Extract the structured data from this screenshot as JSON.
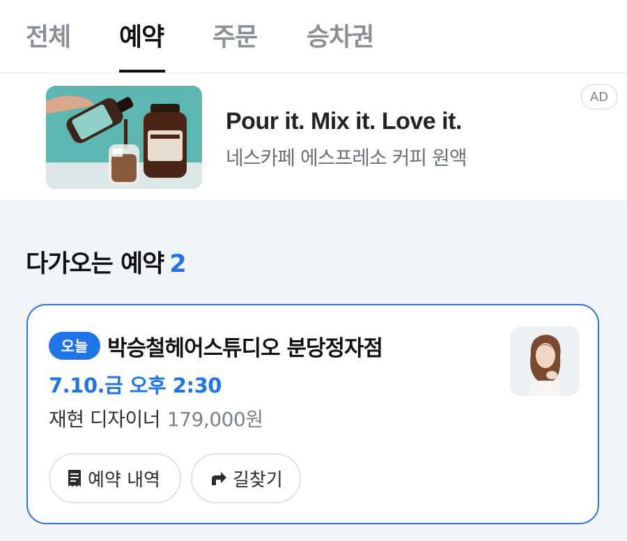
{
  "tabs": [
    {
      "label": "전체",
      "active": false
    },
    {
      "label": "예약",
      "active": true
    },
    {
      "label": "주문",
      "active": false
    },
    {
      "label": "승차권",
      "active": false
    }
  ],
  "ad": {
    "title": "Pour it. Mix it. Love it.",
    "subtitle": "네스카페 에스프레소 커피 원액",
    "badge": "AD",
    "image_icon": "coffee-product-image"
  },
  "upcoming": {
    "title": "다가오는 예약",
    "count": "2"
  },
  "reservation": {
    "badge": "오늘",
    "shop_name": "박승철헤어스튜디오 분당정자점",
    "datetime": "7.10.금 오후 2:30",
    "designer": "재현 디자이너",
    "price": "179,000원",
    "avatar_icon": "designer-avatar",
    "buttons": {
      "history": "예약 내역",
      "route": "길찾기"
    }
  },
  "colors": {
    "accent": "#1f74e6",
    "card_border": "#2a72d9",
    "background": "#f1f4f8"
  }
}
